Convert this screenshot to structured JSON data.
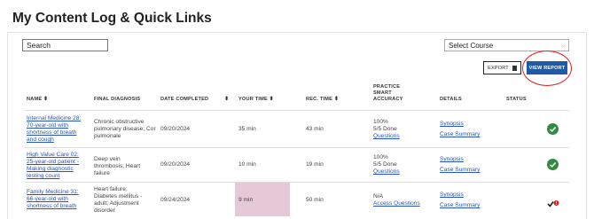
{
  "page": {
    "title": "My Content Log & Quick Links"
  },
  "controls": {
    "search_placeholder": "Search",
    "course_select": "Select Course",
    "export_label": "EXPORT",
    "view_report_label": "VIEW REPORT"
  },
  "table": {
    "headers": {
      "name": "NAME",
      "diagnosis": "FINAL DIAGNOSIS",
      "date": "DATE COMPLETED",
      "your_time": "YOUR TIME",
      "rec_time": "REC. TIME",
      "accuracy": "PRACTICE SMART ACCURACY",
      "details": "DETAILS",
      "status": "STATUS"
    },
    "rows": [
      {
        "name": "Internal Medicine 28: 70-year-old with shortness of breath and cough",
        "diagnosis": "Chronic obstructive pulmonary disease; Cor pulmonale",
        "date": "09/20/2024",
        "your_time": "35 min",
        "rec_time": "43 min",
        "accuracy_pct": "100%",
        "accuracy_done": "5/5 Done",
        "accuracy_link": "Questions",
        "synopsis": "Synopsis",
        "case_summary": "Case Summary",
        "status": "complete"
      },
      {
        "name": "High Value Care 02: 25-year-old patient - Making diagnostic testing count",
        "diagnosis": "Deep vein thrombosis; Heart failure",
        "date": "09/20/2024",
        "your_time": "10 min",
        "rec_time": "19 min",
        "accuracy_pct": "100%",
        "accuracy_done": "5/5 Done",
        "accuracy_link": "Questions",
        "synopsis": "Synopsis",
        "case_summary": "Case Summary",
        "status": "complete"
      },
      {
        "name": "Family Medicine 31: 66-year-old with shortness of breath",
        "diagnosis": "Heart failure; Diabetes mellitus - adult; Adjustment disorder",
        "date": "09/24/2024",
        "your_time": "9 min",
        "rec_time": "50 min",
        "accuracy_pct": "N/A",
        "accuracy_done": "",
        "accuracy_link": "Access Questions",
        "synopsis": "Synopsis",
        "case_summary": "Case Summary",
        "status": "warning"
      }
    ]
  },
  "colors": {
    "accent": "#1f5aa6",
    "link": "#2a55b8",
    "success": "#2f8b3f",
    "highlight": "#e6c9d6",
    "annotation": "#e02020"
  }
}
